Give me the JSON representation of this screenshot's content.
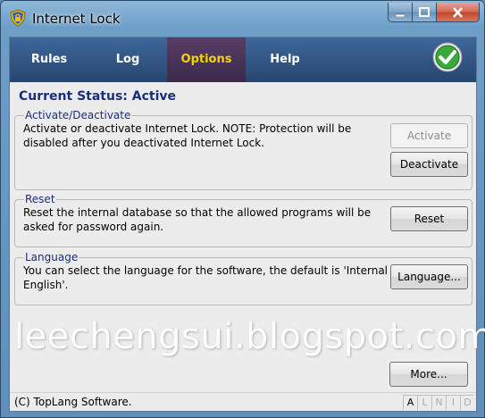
{
  "window": {
    "title": "Internet Lock",
    "icon": "padlock-shield-icon"
  },
  "window_controls": {
    "minimize_icon": "minimize-icon",
    "maximize_icon": "maximize-icon",
    "close_icon": "close-icon"
  },
  "nav": {
    "tabs": [
      {
        "label": "Rules",
        "active": false
      },
      {
        "label": "Log",
        "active": false
      },
      {
        "label": "Options",
        "active": true
      },
      {
        "label": "Help",
        "active": false
      }
    ],
    "ok_icon": "green-checkmark-icon"
  },
  "status": {
    "title": "Current Status: Active"
  },
  "groups": {
    "activate": {
      "title": "Activate/Deactivate",
      "desc": "Activate or deactivate Internet Lock. NOTE: Protection will be disabled after you deactivated Internet Lock.",
      "activate_label": "Activate",
      "deactivate_label": "Deactivate"
    },
    "reset": {
      "title": "Reset",
      "desc": "Reset the internal database so that the allowed programs will be asked for password again.",
      "reset_label": "Reset"
    },
    "language": {
      "title": "Language",
      "desc": "You can select the language for the software, the default is 'Internal English'.",
      "language_label": "Language..."
    }
  },
  "watermark": "leechengsui.blogspot.com",
  "more_label": "More...",
  "statusbar": {
    "copyright": "(C) TopLang Software.",
    "indicators": [
      "A",
      "L",
      "N",
      "I",
      "D"
    ]
  },
  "colors": {
    "nav_bg": "#2f5384",
    "nav_active": "#4a3358",
    "nav_active_text": "#f5d300",
    "heading": "#1a2f7a"
  }
}
